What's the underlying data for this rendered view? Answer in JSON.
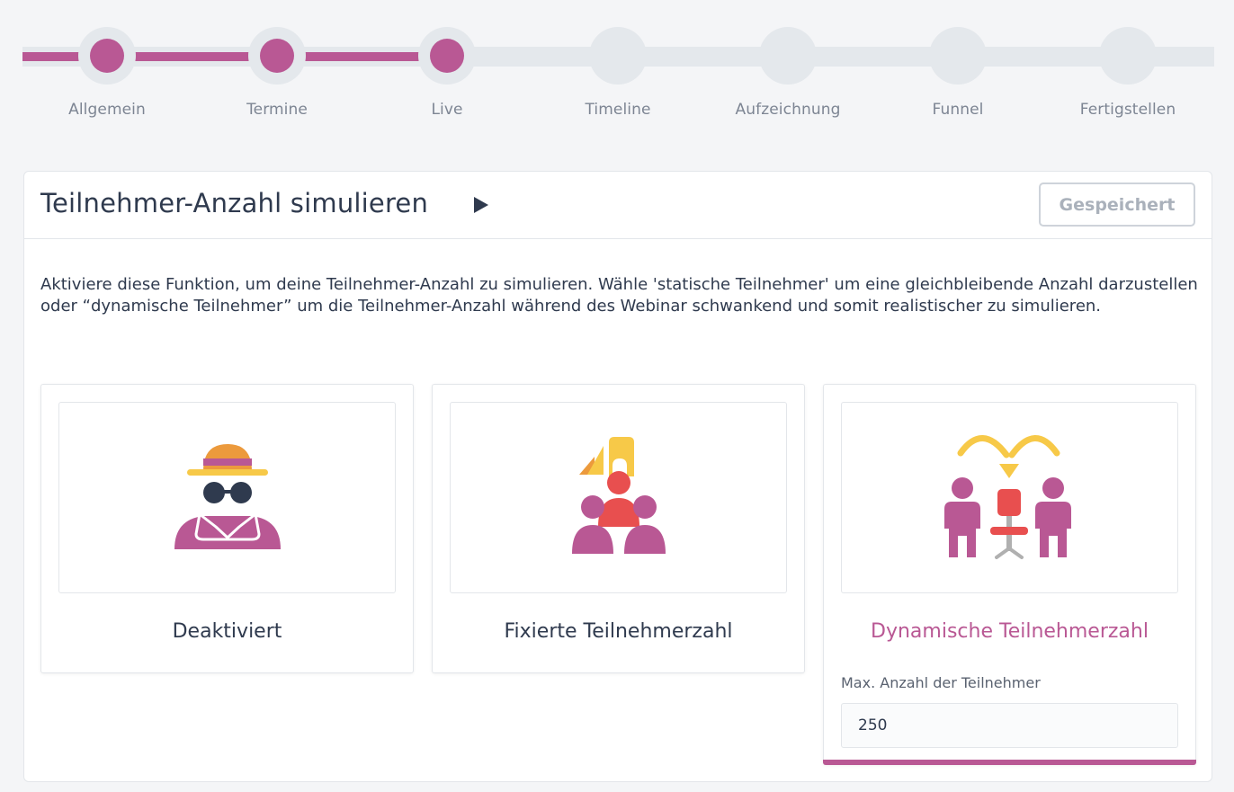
{
  "stepper": {
    "steps": [
      {
        "label": "Allgemein",
        "state": "done"
      },
      {
        "label": "Termine",
        "state": "done"
      },
      {
        "label": "Live",
        "state": "current"
      },
      {
        "label": "Timeline",
        "state": "pending"
      },
      {
        "label": "Aufzeichnung",
        "state": "pending"
      },
      {
        "label": "Funnel",
        "state": "pending"
      },
      {
        "label": "Fertigstellen",
        "state": "pending"
      }
    ],
    "progress_fraction": 0.333
  },
  "card": {
    "title": "Teilnehmer-Anzahl simulieren",
    "play_icon": "play-icon",
    "saved_label": "Gespeichert",
    "description": "Aktiviere diese Funktion, um deine Teilnehmer-Anzahl zu simulieren. Wähle 'statische Teilnehmer' um eine gleichbleibende Anzahl darzustellen oder “dynamische Teilnehmer” um die Teilnehmer-Anzahl während des Webinar schwankend und somit realistischer zu simulieren."
  },
  "options": [
    {
      "label": "Deaktiviert",
      "icon": "incognito-person-icon",
      "selected": false
    },
    {
      "label": "Fixierte Teilnehmerzahl",
      "icon": "fixed-group-icon",
      "selected": false
    },
    {
      "label": "Dynamische Teilnehmerzahl",
      "icon": "dynamic-participants-icon",
      "selected": true
    }
  ],
  "dynamic": {
    "max_label": "Max. Anzahl der Teilnehmer",
    "max_value": "250"
  },
  "colors": {
    "accent": "#b95894",
    "orange": "#ec9a3c",
    "yellow": "#f7c948",
    "red": "#e84f4f",
    "navy": "#2f3a4e",
    "grey": "#b0b0b0"
  }
}
